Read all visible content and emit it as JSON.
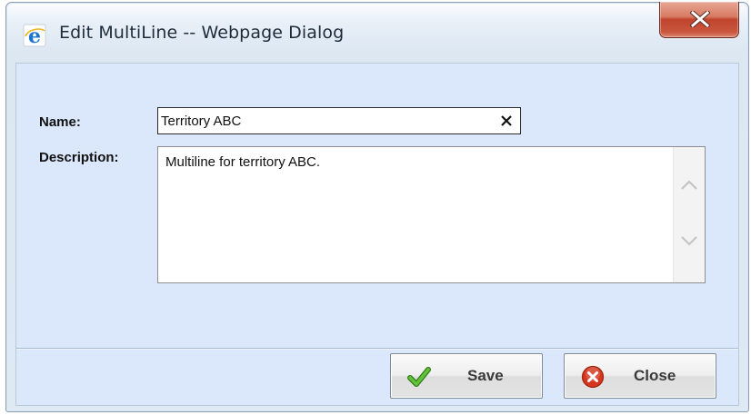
{
  "window": {
    "title": "Edit MultiLine -- Webpage Dialog",
    "app_icon": "internet-explorer-icon",
    "close_icon": "close-icon"
  },
  "form": {
    "name_label": "Name:",
    "name_value": "Territory ABC",
    "description_label": "Description:",
    "description_value": "Multiline for territory ABC."
  },
  "buttons": {
    "save_label": "Save",
    "save_icon": "checkmark-icon",
    "close_label": "Close",
    "close_icon": "cancel-circle-icon"
  },
  "colors": {
    "client_background": "#dbe7fb",
    "close_button_red": "#c1442c",
    "checkmark_green": "#3d9a1e",
    "cancel_red": "#d4351c"
  }
}
